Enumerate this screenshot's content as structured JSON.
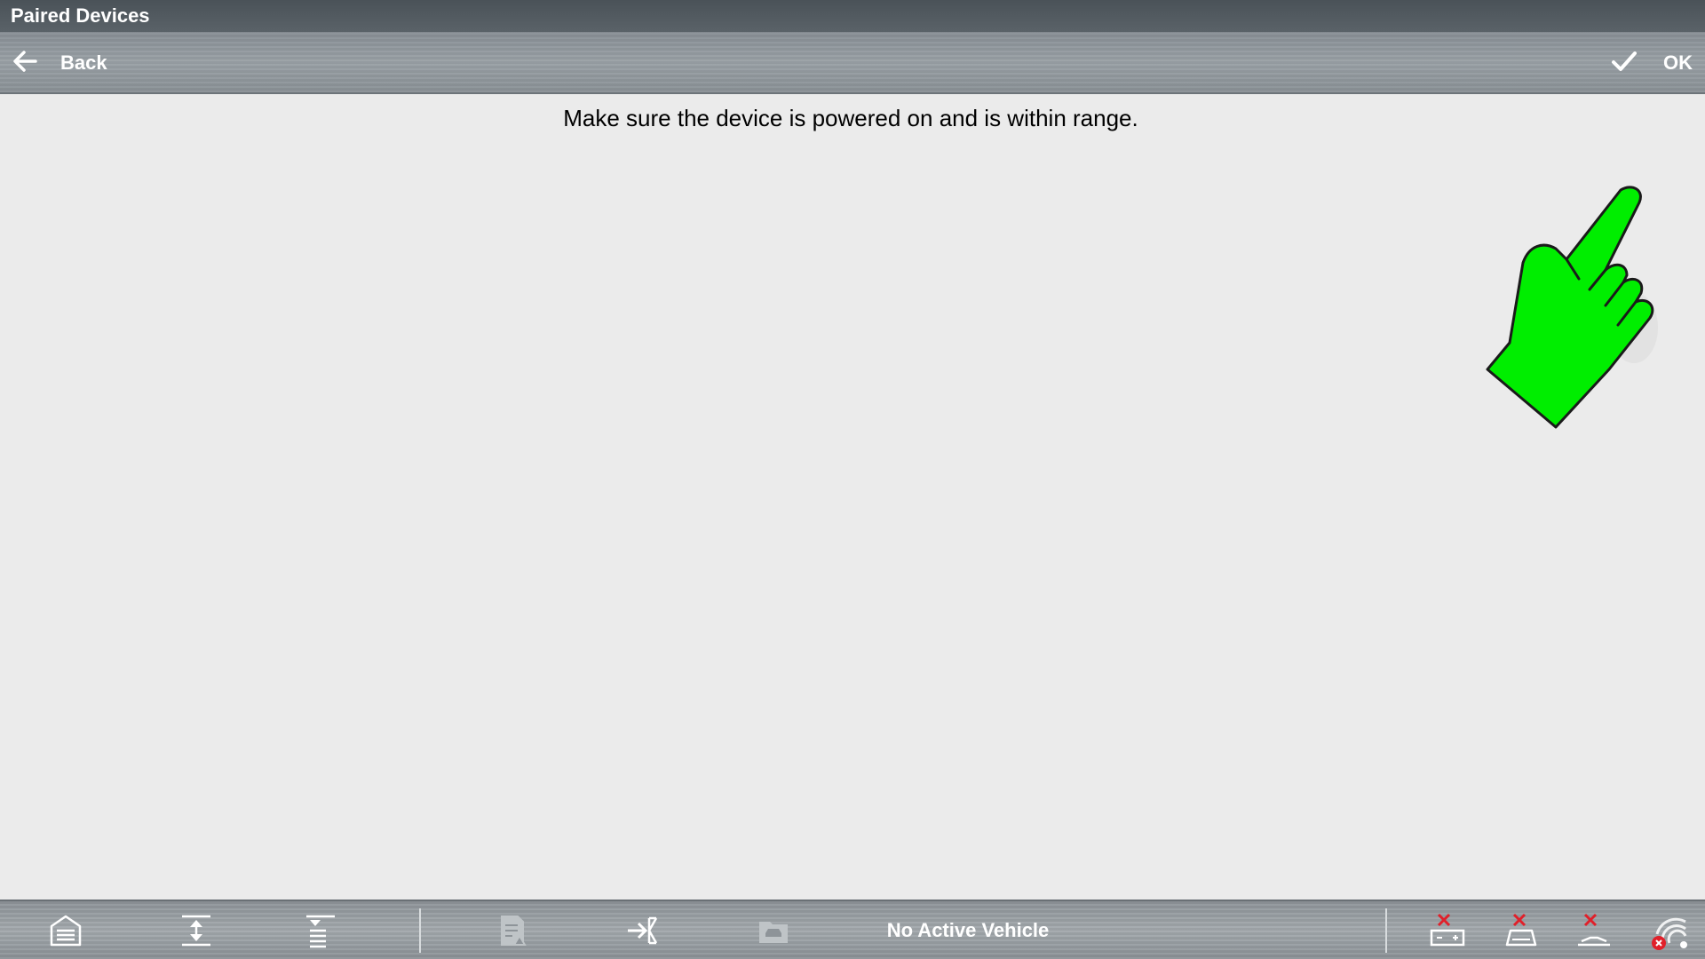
{
  "window": {
    "title": "Paired Devices"
  },
  "actionbar": {
    "back_label": "Back",
    "ok_label": "OK"
  },
  "main": {
    "message": "Make sure the device is powered on and is within range."
  },
  "bottombar": {
    "status": "No Active Vehicle",
    "icons": [
      "home-icon",
      "expand-vertical-icon",
      "collapse-list-icon",
      "report-icon",
      "exit-to-icon",
      "vehicle-folder-icon",
      "battery-disconnected-icon",
      "scanner-disconnected-icon",
      "scope-disconnected-icon",
      "wifi-error-icon"
    ]
  },
  "colors": {
    "pointer_green": "#00ff00",
    "error_red": "#e0202a",
    "bar_gray": "#9aa1a6"
  }
}
